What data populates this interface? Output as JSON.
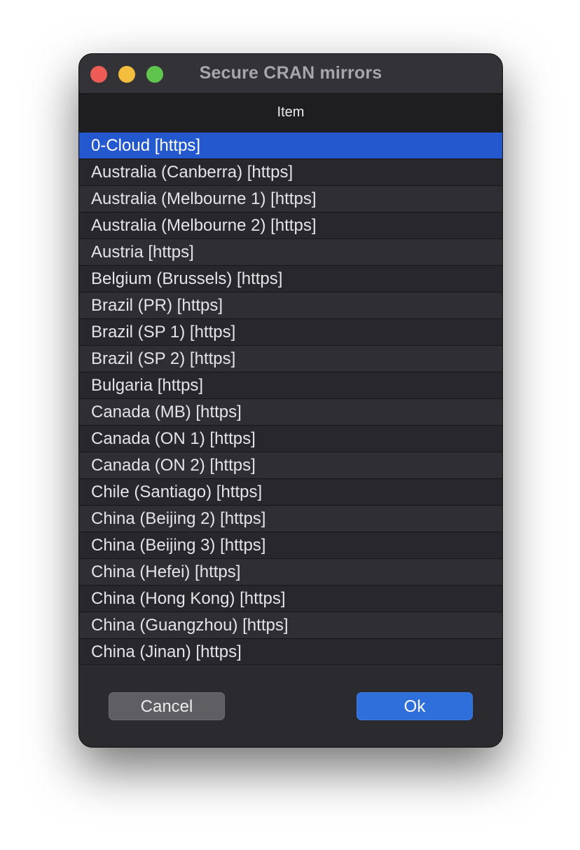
{
  "window": {
    "title": "Secure CRAN mirrors"
  },
  "table": {
    "column_header": "Item",
    "selected_index": 0,
    "rows": [
      "0-Cloud [https]",
      "Australia (Canberra) [https]",
      "Australia (Melbourne 1) [https]",
      "Australia (Melbourne 2) [https]",
      "Austria [https]",
      "Belgium (Brussels) [https]",
      "Brazil (PR) [https]",
      "Brazil (SP 1) [https]",
      "Brazil (SP 2) [https]",
      "Bulgaria [https]",
      "Canada (MB) [https]",
      "Canada (ON 1) [https]",
      "Canada (ON 2) [https]",
      "Chile (Santiago) [https]",
      "China (Beijing 2) [https]",
      "China (Beijing 3) [https]",
      "China (Hefei) [https]",
      "China (Hong Kong) [https]",
      "China (Guangzhou) [https]",
      "China (Jinan) [https]"
    ]
  },
  "buttons": {
    "cancel_label": "Cancel",
    "ok_label": "Ok"
  },
  "colors": {
    "selection": "#2458cf",
    "ok_button": "#2f6fdc",
    "close": "#ee5d55",
    "minimize": "#f3bd3e",
    "maximize": "#5ec44e"
  }
}
